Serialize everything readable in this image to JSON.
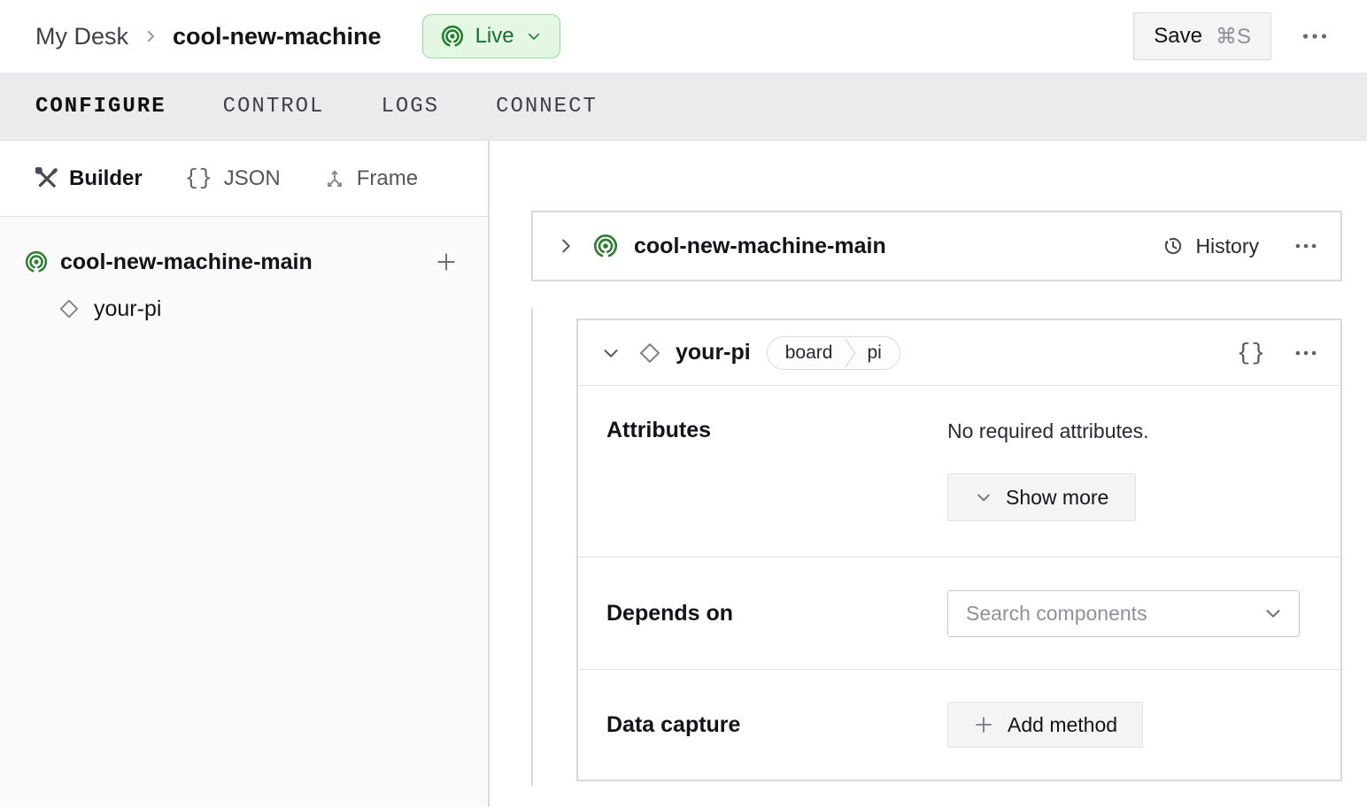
{
  "colors": {
    "accent_green": "#2e7d32",
    "live_badge_bg": "#e3f7e3",
    "live_badge_border": "#9bd89f",
    "live_badge_text": "#1e6e2c"
  },
  "header": {
    "breadcrumb": {
      "parent": "My Desk",
      "current": "cool-new-machine"
    },
    "live": {
      "label": "Live",
      "icon": "live-broadcast-icon"
    },
    "save": {
      "label": "Save",
      "shortcut": "⌘S"
    },
    "more_icon": "ellipsis-icon"
  },
  "tabs": [
    {
      "label": "CONFIGURE",
      "active": true
    },
    {
      "label": "CONTROL",
      "active": false
    },
    {
      "label": "LOGS",
      "active": false
    },
    {
      "label": "CONNECT",
      "active": false
    }
  ],
  "sidebar": {
    "view_tabs": [
      {
        "label": "Builder",
        "icon": "crossed-tools-icon",
        "active": true
      },
      {
        "label": "JSON",
        "icon": "braces-icon",
        "active": false
      },
      {
        "label": "Frame",
        "icon": "frame-axes-icon",
        "active": false
      }
    ],
    "tree": {
      "machine": {
        "name": "cool-new-machine-main",
        "icon": "machine-live-icon",
        "add_icon": "plus-icon"
      },
      "components": [
        {
          "name": "your-pi",
          "icon": "diamond-icon"
        }
      ]
    }
  },
  "main": {
    "machine_card": {
      "title": "cool-new-machine-main",
      "history_label": "History"
    },
    "component_card": {
      "name": "your-pi",
      "type_badge": {
        "type": "board",
        "model": "pi"
      },
      "braces_icon": "{}",
      "attributes": {
        "label": "Attributes",
        "empty_text": "No required attributes.",
        "show_more_label": "Show more"
      },
      "depends_on": {
        "label": "Depends on",
        "search_placeholder": "Search components"
      },
      "data_capture": {
        "label": "Data capture",
        "add_method_label": "Add method"
      }
    }
  }
}
